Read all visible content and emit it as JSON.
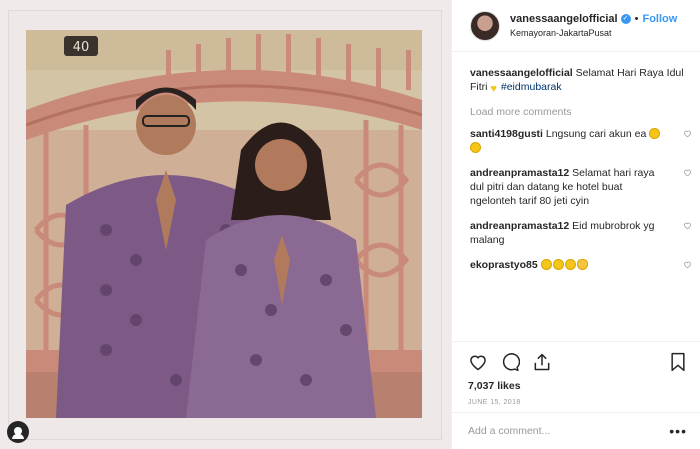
{
  "post": {
    "username": "vanessaangelofficial",
    "verified_symbol": "✓",
    "separator": "•",
    "follow_label": "Follow",
    "location": "Kemayoran-JakartaPusat",
    "caption": {
      "username": "vanessaangelofficial",
      "text": "Selamat Hari Raya Idul Fitri",
      "hashtag": "#eidmubarak"
    },
    "load_more_label": "Load more comments",
    "comments": [
      {
        "username": "santi4198gusti",
        "text": "Lngsung cari akun ea"
      },
      {
        "username": "andreanpramasta12",
        "text": "Selamat hari raya dul pitri dan datang ke hotel buat ngelonteh tarif 80 jeti cyin"
      },
      {
        "username": "andreanpramasta12",
        "text": "Eid mubrobrok yg malang"
      },
      {
        "username": "ekoprastyo85",
        "text": ""
      }
    ],
    "likes": "7,037 likes",
    "date": "JUNE 15, 2018",
    "add_comment_placeholder": "Add a comment...",
    "more_options": "•••"
  },
  "photo": {
    "house_number": "40"
  },
  "colors": {
    "accent": "#3897f0",
    "fence": "#c98a7a",
    "wall": "#d9c9ad"
  }
}
